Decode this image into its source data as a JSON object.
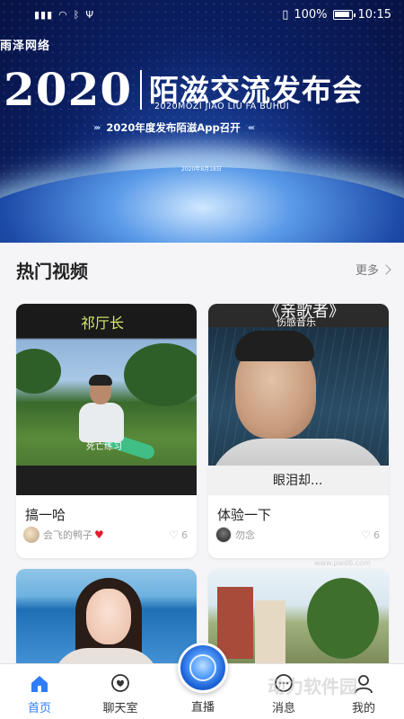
{
  "status_bar": {
    "battery": "100%",
    "time": "10:15"
  },
  "banner": {
    "brand": "雨泽网络",
    "year": "2020",
    "title": "陌滋交流发布会",
    "pinyin": "2020MOZI JIAO LIU FA BUHUI",
    "subtitle": "2020年度发布陌滋App召开",
    "date": "2020年8月18日"
  },
  "section": {
    "title": "热门视频",
    "more_label": "更多"
  },
  "cards": [
    {
      "caption": "祁厅长",
      "subtitle_text": "死亡练习",
      "title": "搞一哈",
      "author": "会飞的鸭子",
      "likes": "6"
    },
    {
      "caption": "《亲歌者》",
      "caption_sub": "伤感音乐",
      "subtitle_text": "眼泪却...",
      "title": "体验一下",
      "author": "勿念",
      "likes": "6"
    },
    {
      "title": ""
    },
    {
      "title": ""
    }
  ],
  "tab_bar": {
    "home": "首页",
    "chat": "聊天室",
    "live": "直播",
    "messages": "消息",
    "me": "我的"
  },
  "watermark": {
    "text": "动力软件园",
    "url": "www.pwd6.com"
  },
  "colors": {
    "accent": "#2f7df6",
    "like_red": "#e21b2f"
  }
}
